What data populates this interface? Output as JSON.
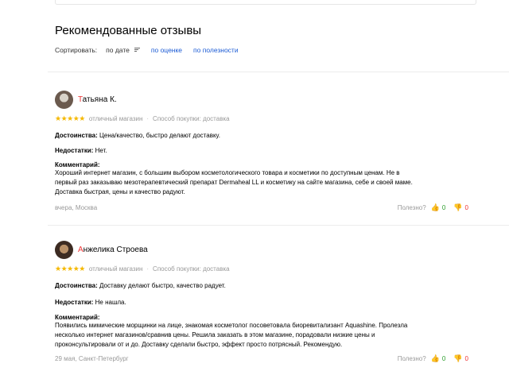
{
  "section": {
    "heading": "Рекомендованные отзывы",
    "sort_label": "Сортировать:",
    "sort_options": [
      "по дате",
      "по оценке",
      "по полезности"
    ]
  },
  "reviews": [
    {
      "name_first_letter": "Т",
      "name_rest": "атьяна К.",
      "rating": 5,
      "stars": "★★★★★",
      "rating_text": "отличный магазин",
      "purchase": "Способ покупки: доставка",
      "pros_label": "Достоинства:",
      "pros": "Цена/качество, быстро делают доставку.",
      "cons_label": "Недостатки:",
      "cons": "Нет.",
      "comment_label": "Комментарий:",
      "comment_lines": [
        "Хороший интернет магазин, с большим выбором косметологического товара и косметики по доступным ценам. Не в",
        "первый раз заказываю мезотерапевтический препарат Dermaheal LL и косметику на сайте магазина, себе и своей маме.",
        "Доставка быстрая, цены и качество радуют."
      ],
      "date_place": "вчера, Москва",
      "helpful": "Полезно?",
      "up": "0",
      "down": "0"
    },
    {
      "name_first_letter": "А",
      "name_rest": "нжелика Строева",
      "rating": 5,
      "stars": "★★★★★",
      "rating_text": "отличный магазин",
      "purchase": "Способ покупки: доставка",
      "pros_label": "Достоинства:",
      "pros": "Доставку делают быстро, качество радует.",
      "cons_label": "Недостатки:",
      "cons": "Не нашла.",
      "comment_label": "Комментарий:",
      "comment_lines": [
        "Появились мимические морщинки на лице, знакомая косметолог посоветовала биоревитализант Aquashine. Пролезла",
        "несколько интернет магазинов/сравнив цены. Решила заказать в этом магазине, порадовали низкие цены и",
        "проконсультировали от и до. Доставку сделали быстро, эффект просто потрясный. Рекомендую."
      ],
      "date_place": "29 мая, Санкт-Петербург",
      "helpful": "Полезно?",
      "up": "0",
      "down": "0"
    }
  ],
  "colors": {
    "accent_link": "#1a5ad4",
    "star": "#f5b800",
    "name_initial": "#e33333",
    "vote_up": "#2a9d2a",
    "vote_down": "#e33333"
  },
  "icons": {
    "sort": "sort-lines-icon",
    "vote_up": "thumb-up-icon",
    "vote_down": "thumb-down-icon"
  }
}
